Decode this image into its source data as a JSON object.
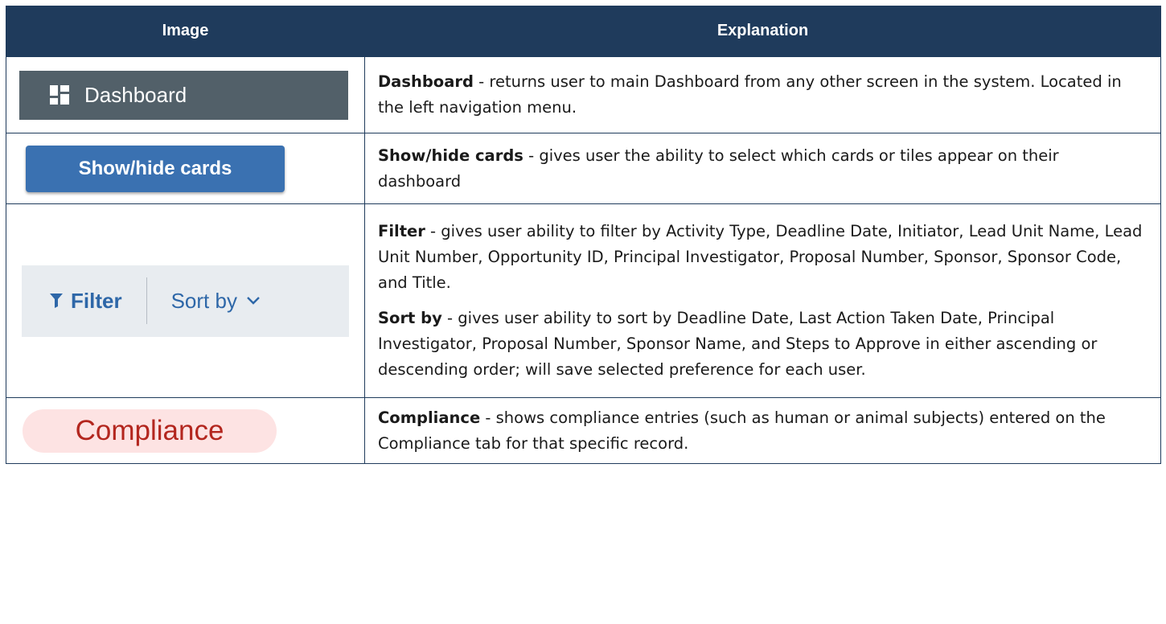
{
  "header": {
    "image": "Image",
    "explanation": "Explanation"
  },
  "rows": [
    {
      "sample": {
        "label": "Dashboard",
        "icon": "dashboard-grid-icon"
      },
      "term": "Dashboard",
      "text": " - returns user to main Dashboard from any other screen in the system. Located in the left navigation menu."
    },
    {
      "sample": {
        "label": "Show/hide cards"
      },
      "term": "Show/hide cards",
      "text": " - gives user the ability to select which cards or tiles appear on their dashboard"
    },
    {
      "sample": {
        "filter_label": "Filter",
        "filter_icon": "funnel-icon",
        "sort_label": "Sort by",
        "sort_icon": "chevron-down-icon"
      },
      "term": "Filter",
      "text": " - gives user ability to filter by Activity Type, Deadline Date, Initiator, Lead Unit Name, Lead Unit Number, Opportunity ID, Principal Investigator, Proposal Number, Sponsor, Sponsor Code, and Title.",
      "term2": "Sort by",
      "text2": " - gives user ability to sort by Deadline Date, Last Action Taken Date, Principal Investigator, Proposal Number, Sponsor Name, and Steps to Approve in either ascending or descending order; will save selected preference for each user."
    },
    {
      "sample": {
        "label": "Compliance"
      },
      "term": "Compliance",
      "text": " - shows compliance entries (such as human or animal subjects) entered on the Compliance tab for that specific record."
    }
  ],
  "colors": {
    "header_bg": "#1f3b5c",
    "dashboard_bg": "#526069",
    "button_bg": "#3a71b1",
    "filter_bg": "#e8ecf0",
    "filter_text": "#2e67a8",
    "pill_bg": "#fde3e3",
    "pill_text": "#b3261e"
  }
}
